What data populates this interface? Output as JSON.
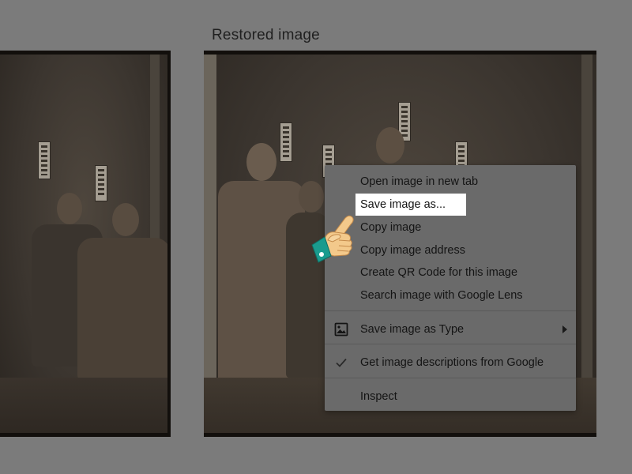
{
  "heading": "Restored image",
  "menu": {
    "items": [
      {
        "label": "Open image in new tab"
      },
      {
        "label": "Save image as..."
      },
      {
        "label": "Copy image"
      },
      {
        "label": "Copy image address"
      },
      {
        "label": "Create QR Code for this image"
      },
      {
        "label": "Search image with Google Lens"
      },
      {
        "label": "Save image as Type",
        "icon": "image-icon",
        "submenu": true
      },
      {
        "label": "Get image descriptions from Google",
        "icon": "check-icon"
      },
      {
        "label": "Inspect"
      }
    ],
    "highlighted": "Save image as..."
  },
  "colors": {
    "overlay": "#7b7b7b",
    "menu_bg": "#6a6a6a",
    "highlight": "#ffffff",
    "hand_cuff": "#1a9b8e",
    "hand_skin": "#f3c98b"
  },
  "icons": [
    "pointing-hand-icon",
    "image-icon",
    "check-icon",
    "chevron-right-icon"
  ]
}
